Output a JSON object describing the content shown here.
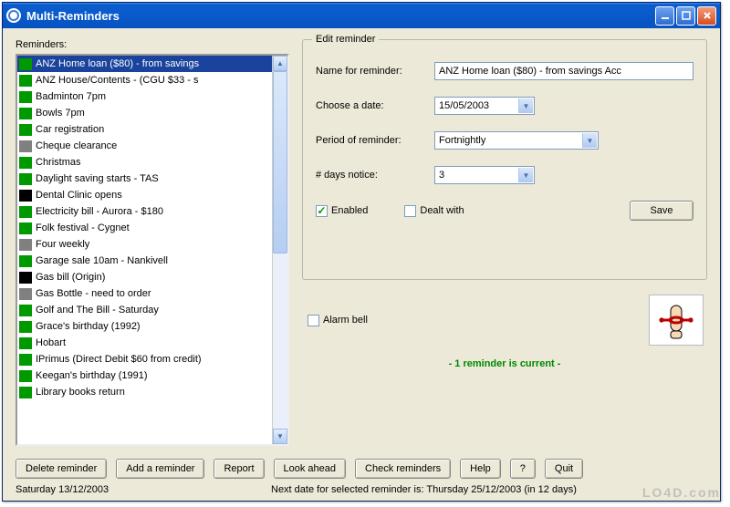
{
  "window": {
    "title": "Multi-Reminders"
  },
  "left": {
    "label": "Reminders:",
    "items": [
      {
        "color": "green",
        "text": "ANZ Home loan ($80) - from savings",
        "selected": true
      },
      {
        "color": "green",
        "text": "ANZ House/Contents - (CGU $33 - s"
      },
      {
        "color": "green",
        "text": "Badminton 7pm"
      },
      {
        "color": "green",
        "text": "Bowls 7pm"
      },
      {
        "color": "green",
        "text": "Car registration"
      },
      {
        "color": "gray",
        "text": "Cheque clearance"
      },
      {
        "color": "green",
        "text": "Christmas"
      },
      {
        "color": "green",
        "text": "Daylight saving starts - TAS"
      },
      {
        "color": "black",
        "text": "Dental Clinic opens"
      },
      {
        "color": "green",
        "text": "Electricity bill - Aurora - $180"
      },
      {
        "color": "green",
        "text": "Folk festival - Cygnet"
      },
      {
        "color": "gray",
        "text": "Four weekly"
      },
      {
        "color": "green",
        "text": "Garage sale 10am - Nankivell"
      },
      {
        "color": "black",
        "text": "Gas bill (Origin)"
      },
      {
        "color": "gray",
        "text": "Gas Bottle - need to order"
      },
      {
        "color": "green",
        "text": "Golf and The Bill - Saturday"
      },
      {
        "color": "green",
        "text": "Grace's birthday (1992)"
      },
      {
        "color": "green",
        "text": "Hobart"
      },
      {
        "color": "green",
        "text": "IPrimus (Direct Debit $60 from credit)"
      },
      {
        "color": "green",
        "text": "Keegan's birthday (1991)"
      },
      {
        "color": "green",
        "text": "Library books return"
      }
    ]
  },
  "form": {
    "legend": "Edit reminder",
    "name_label": "Name for reminder:",
    "name_value": "ANZ Home loan ($80) - from savings Acc",
    "date_label": "Choose a date:",
    "date_value": "15/05/2003",
    "period_label": "Period of reminder:",
    "period_value": "Fortnightly",
    "notice_label": "# days notice:",
    "notice_value": "3",
    "enabled_label": "Enabled",
    "dealt_label": "Dealt with",
    "save_label": "Save",
    "alarm_label": "Alarm bell"
  },
  "status_msg": "- 1 reminder is current -",
  "buttons": {
    "delete": "Delete reminder",
    "add": "Add a reminder",
    "report": "Report",
    "lookahead": "Look ahead",
    "check": "Check reminders",
    "help": "Help",
    "q": "?",
    "quit": "Quit"
  },
  "statusbar": {
    "date": "Saturday   13/12/2003",
    "next": "Next date for selected reminder is: Thursday 25/12/2003 (in 12 days)"
  },
  "watermark": "LO4D.com"
}
